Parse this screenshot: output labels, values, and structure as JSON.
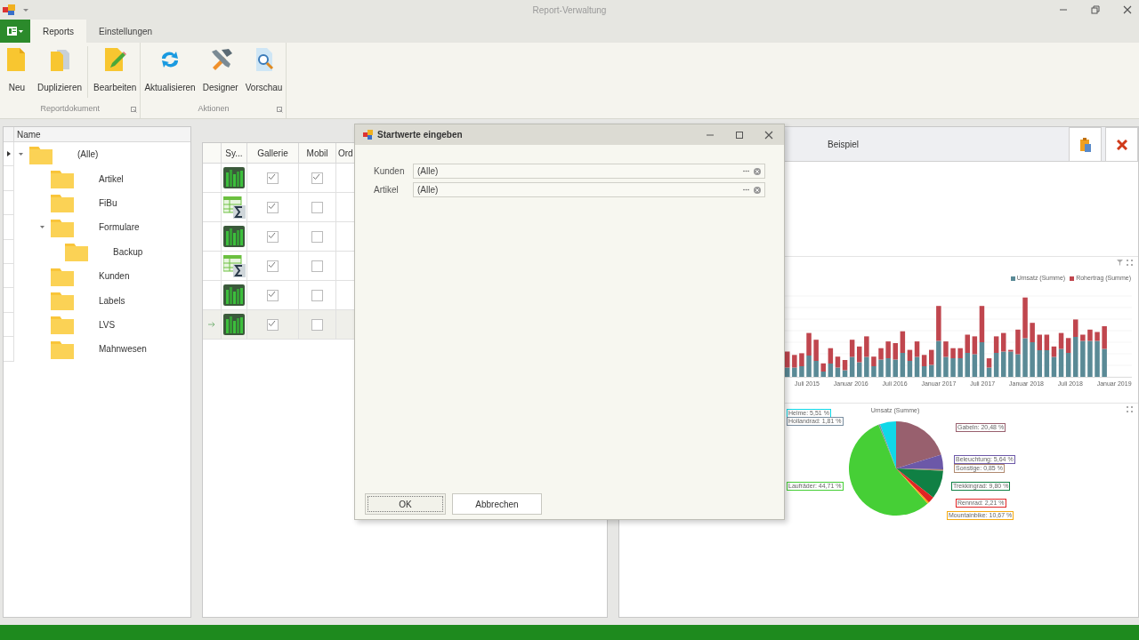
{
  "window": {
    "title": "Report-Verwaltung"
  },
  "ribbon": {
    "tabs": [
      {
        "label": "Reports",
        "selected": true
      },
      {
        "label": "Einstellungen",
        "selected": false
      }
    ],
    "groups": [
      {
        "label": "Reportdokument",
        "buttons": [
          {
            "label": "Neu",
            "kind": "new"
          },
          {
            "label": "Duplizieren",
            "kind": "duplicate"
          },
          {
            "label": "Bearbeiten",
            "kind": "edit"
          }
        ]
      },
      {
        "label": "Aktionen",
        "buttons": [
          {
            "label": "Aktualisieren",
            "kind": "refresh"
          },
          {
            "label": "Designer",
            "kind": "designer"
          },
          {
            "label": "Vorschau",
            "kind": "preview"
          }
        ]
      }
    ]
  },
  "tree": {
    "column": "Name",
    "items": [
      {
        "label": "(Alle)",
        "expanded": true,
        "current": true,
        "children": [
          {
            "label": "Artikel"
          },
          {
            "label": "FiBu"
          },
          {
            "label": "Formulare",
            "expanded": true,
            "children": [
              {
                "label": "Backup"
              }
            ]
          },
          {
            "label": "Kunden"
          },
          {
            "label": "Labels"
          },
          {
            "label": "LVS"
          },
          {
            "label": "Mahnwesen"
          }
        ]
      }
    ]
  },
  "grid": {
    "columns": [
      "Sy...",
      "Gallerie",
      "Mobil",
      "Ord"
    ],
    "rows": [
      {
        "kind": "chart",
        "gallery": true,
        "mobile": true,
        "current": false
      },
      {
        "kind": "table",
        "gallery": true,
        "mobile": false,
        "current": false
      },
      {
        "kind": "chart",
        "gallery": true,
        "mobile": false,
        "current": false
      },
      {
        "kind": "table",
        "gallery": true,
        "mobile": false,
        "current": false
      },
      {
        "kind": "chart",
        "gallery": true,
        "mobile": false,
        "current": false
      },
      {
        "kind": "chart",
        "gallery": true,
        "mobile": false,
        "current": true
      }
    ]
  },
  "preview": {
    "title": "Beispiel",
    "bar_chart": {
      "legend": [
        {
          "label": "Umsatz (Summe)",
          "color": "#5a8a96"
        },
        {
          "label": "Rohertrag (Summe)",
          "color": "#c0464e"
        }
      ],
      "x_labels": [
        "Juli 2015",
        "Januar 2016",
        "Juli 2016",
        "Januar 2017",
        "Juli 2017",
        "Januar 2018",
        "Juli 2018",
        "Januar 2019"
      ]
    },
    "pie_chart": {
      "title": "Umsatz (Summe)",
      "labels": [
        {
          "text": "Helme: 5,51 %",
          "color": "#10d8e8"
        },
        {
          "text": "Hollandrad: 1,81 %",
          "color": "#7a8ea0"
        },
        {
          "text": "Laufräder: 44,71 %",
          "color": "#46cf36"
        },
        {
          "text": "Gabeln: 20,48 %",
          "color": "#98606e"
        },
        {
          "text": "Beleuchtung: 5,64 %",
          "color": "#6c58a8"
        },
        {
          "text": "Sonstige: 0,85 %",
          "color": "#b08a70"
        },
        {
          "text": "Trekkingrad: 9,80 %",
          "color": "#108044"
        },
        {
          "text": "Rennrad: 2,21 %",
          "color": "#e02424"
        },
        {
          "text": "Mountainbike: 10,67 %",
          "color": "#f5ab12"
        }
      ]
    }
  },
  "dialog": {
    "title": "Startwerte eingeben",
    "fields": [
      {
        "label": "Kunden",
        "value": "(Alle)"
      },
      {
        "label": "Artikel",
        "value": "(Alle)"
      }
    ],
    "buttons": [
      {
        "label": "OK",
        "focused": true
      },
      {
        "label": "Abbrechen",
        "focused": false
      }
    ]
  }
}
